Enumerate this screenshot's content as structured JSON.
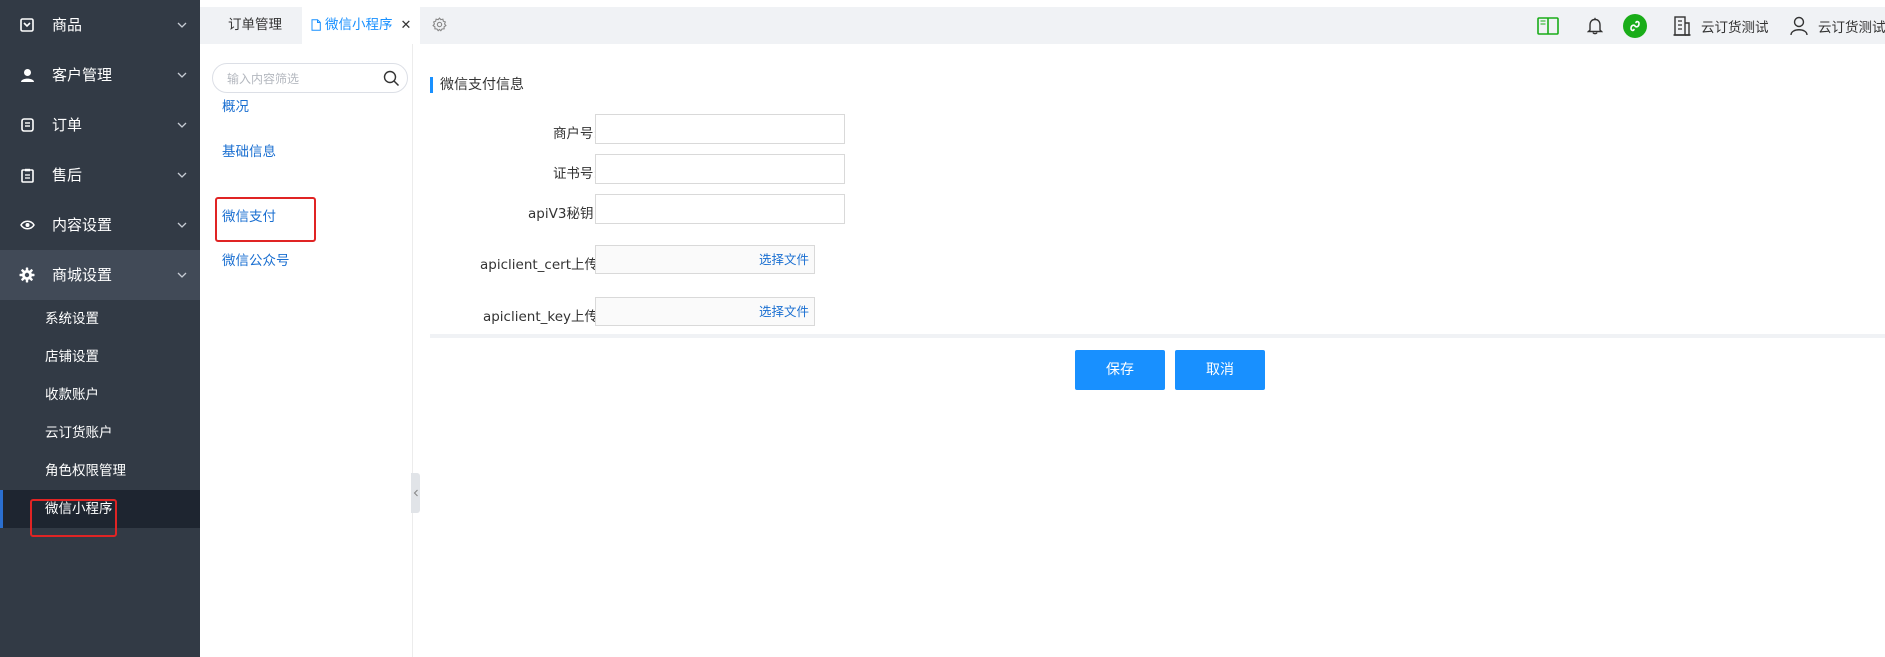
{
  "sidebar": {
    "groups": [
      {
        "label": "商品",
        "icon": "product-icon"
      },
      {
        "label": "客户管理",
        "icon": "user-icon"
      },
      {
        "label": "订单",
        "icon": "order-icon"
      },
      {
        "label": "售后",
        "icon": "after-sales-icon"
      },
      {
        "label": "内容设置",
        "icon": "eye-icon"
      },
      {
        "label": "商城设置",
        "icon": "gear-icon"
      }
    ],
    "sub_items": [
      "系统设置",
      "店铺设置",
      "收款账户",
      "云订货账户",
      "角色权限管理",
      "微信小程序"
    ],
    "active_sub_item": "微信小程序"
  },
  "tabs": {
    "items": [
      {
        "label": "订单管理"
      },
      {
        "label": "微信小程序",
        "close": "✕"
      }
    ]
  },
  "header": {
    "company": "云订货测试",
    "user": "云订货测试"
  },
  "subnav": {
    "search_placeholder": "输入内容筛选",
    "items": [
      "概况",
      "基础信息",
      "微信支付",
      "微信公众号"
    ]
  },
  "form": {
    "section_title": "微信支付信息",
    "fields": [
      {
        "label": "商户号:",
        "value": ""
      },
      {
        "label": "证书号:",
        "value": ""
      },
      {
        "label": "apiV3秘钥:",
        "value": ""
      }
    ],
    "uploads": [
      {
        "label": "apiclient_cert上传",
        "button": "选择文件"
      },
      {
        "label": "apiclient_key上传",
        "button": "选择文件"
      }
    ],
    "save_label": "保存",
    "cancel_label": "取消"
  },
  "colors": {
    "sidebar_bg": "#323a45",
    "accent": "#1890ff",
    "highlight_box": "#e02424",
    "miniapp_green": "#1aad19"
  }
}
